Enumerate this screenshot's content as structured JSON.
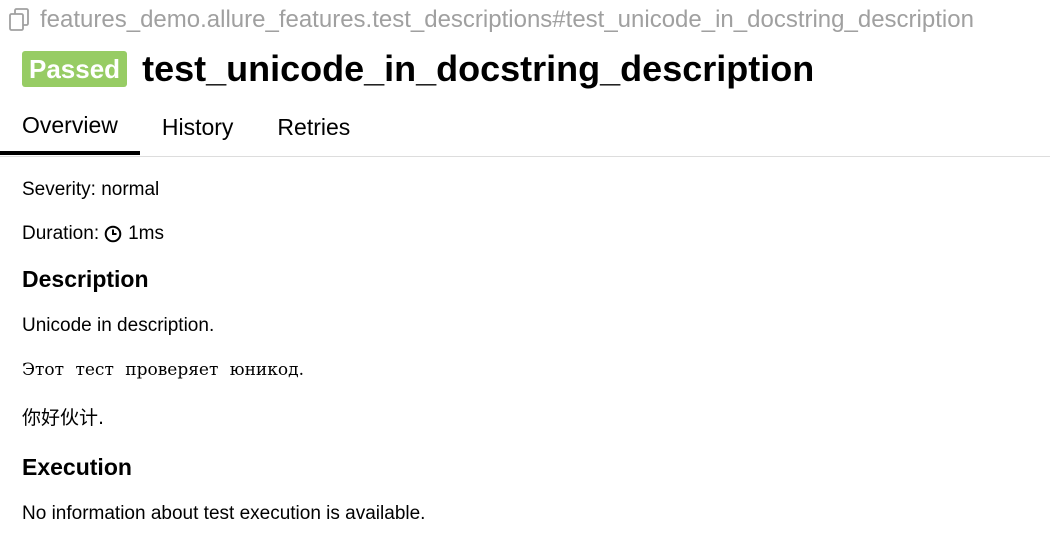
{
  "header": {
    "path": "features_demo.allure_features.test_descriptions#test_unicode_in_docstring_description",
    "copy_icon": "copy-icon"
  },
  "title": {
    "status": "Passed",
    "status_color": "#97cc64",
    "name": "test_unicode_in_docstring_description"
  },
  "tabs": [
    {
      "label": "Overview",
      "active": true
    },
    {
      "label": "History",
      "active": false
    },
    {
      "label": "Retries",
      "active": false
    }
  ],
  "overview": {
    "severity": "Severity: normal",
    "duration_label": "Duration:",
    "duration_icon": "clock-icon",
    "duration_value": "1ms",
    "description_heading": "Description",
    "description_lines": [
      "Unicode in description.",
      "Этот тест проверяет юникод.",
      "你好伙计."
    ],
    "execution_heading": "Execution",
    "execution_text": "No information about test execution is available."
  }
}
